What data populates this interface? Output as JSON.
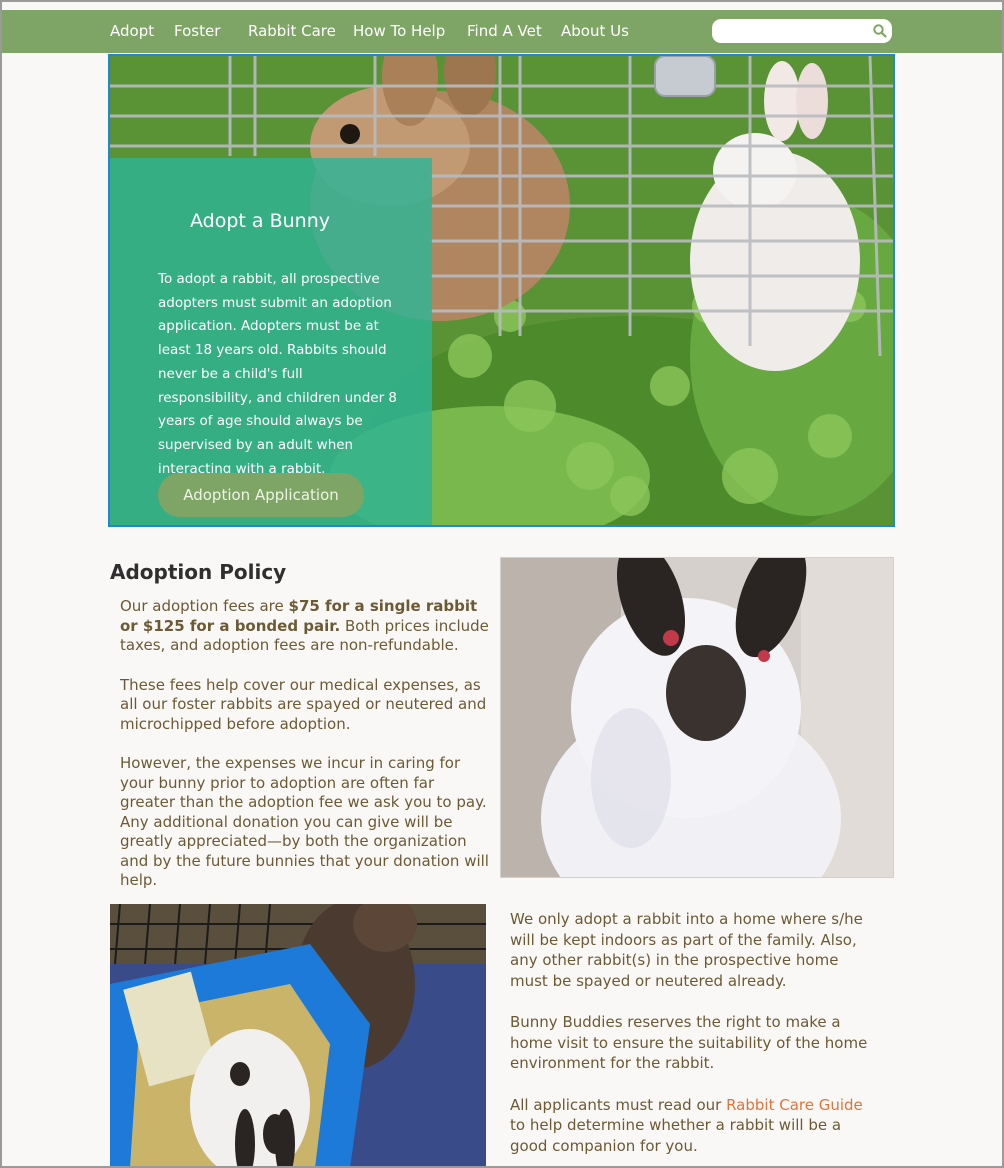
{
  "nav": {
    "items": [
      {
        "label": "Adopt"
      },
      {
        "label": "Foster"
      },
      {
        "label": "Rabbit Care"
      },
      {
        "label": "How To Help"
      },
      {
        "label": "Find A Vet"
      },
      {
        "label": "About Us"
      }
    ],
    "search": {
      "placeholder": "",
      "value": ""
    }
  },
  "hero": {
    "title": "Adopt a Bunny",
    "body": "To adopt a rabbit, all prospective adopters must submit an adoption application. Adopters must be at least 18 years old. Rabbits should never be a child's full responsibility, and children under 8 years of age should always be supervised by an adult when interacting with a rabbit.",
    "button_label": "Adoption  Application"
  },
  "policy": {
    "heading": "Adoption Policy",
    "p1_before": "Our adoption fees are ",
    "p1_bold": "$75 for a single rabbit or $125 for a bonded pair.",
    "p1_after": " Both prices include taxes, and adoption fees are non-refundable.",
    "p2": "These fees help cover our medical expenses, as all our foster rabbits are spayed or neutered and microchipped before adoption.",
    "p3": "However, the expenses we incur in caring for your bunny prior to adoption are often far greater than the adoption fee we ask you to pay.  Any additional donation you can give will be greatly appreciated—by both the organization and by the future bunnies that your donation will help."
  },
  "right": {
    "p1": "We only adopt a rabbit into a home where s/he will be kept indoors as part of the family. Also, any other rabbit(s) in the prospective home must be spayed or neutered already.",
    "p2": "Bunny Buddies reserves the right to make a home visit to ensure the suitability of the home environment for the rabbit.",
    "p3_before": "All applicants must read our ",
    "p3_link": "Rabbit Care Guide",
    "p3_after": " to help determine whether a rabbit will be a good companion for you."
  },
  "colors": {
    "nav_bg": "#7fa566",
    "panel_bg": "#2db496",
    "text_brown": "#6b5a34",
    "link_orange": "#e0733a",
    "hero_border": "#1e88d6"
  },
  "icons": {
    "search": "search-icon"
  }
}
